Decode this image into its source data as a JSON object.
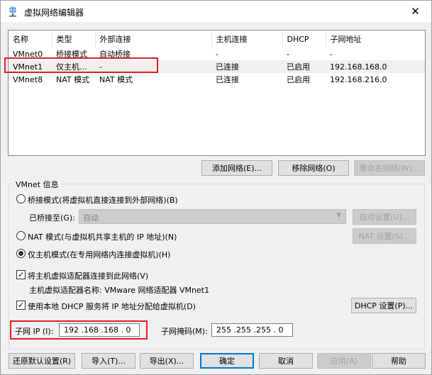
{
  "window": {
    "title": "虚拟网络编辑器",
    "close_glyph": "✕"
  },
  "netlist": {
    "columns": [
      "名称",
      "类型",
      "外部连接",
      "主机连接",
      "DHCP",
      "子网地址"
    ],
    "rows": [
      {
        "name": "VMnet0",
        "type": "桥接模式",
        "external": "自动桥接",
        "host": "-",
        "dhcp": "-",
        "subnet": "-"
      },
      {
        "name": "VMnet1",
        "type": "仅主机...",
        "external": "-",
        "host": "已连接",
        "dhcp": "已启用",
        "subnet": "192.168.168.0"
      },
      {
        "name": "VMnet8",
        "type": "NAT 模式",
        "external": "NAT 模式",
        "host": "已连接",
        "dhcp": "已启用",
        "subnet": "192.168.216.0"
      }
    ]
  },
  "buttons": {
    "add": "添加网络(E)...",
    "remove": "移除网络(O)",
    "rename": "重命名网络(W)...",
    "auto_settings": "自动设置(U)...",
    "nat_settings": "NAT 设置(S)...",
    "dhcp_settings": "DHCP 设置(P)...",
    "restore": "还原默认设置(R)",
    "import": "导入(T)...",
    "export": "导出(X)...",
    "ok": "确定",
    "cancel": "取消",
    "apply": "应用(A)",
    "help": "帮助"
  },
  "vmnet_info": {
    "title": "VMnet 信息",
    "bridge_mode": "桥接模式(将虚拟机直接连接到外部网络)(B)",
    "bridged_to_label": "已桥接至(G):",
    "bridged_to_value": "自动",
    "nat_mode": "NAT 模式(与虚拟机共享主机的 IP 地址)(N)",
    "host_only_mode": "仅主机模式(在专用网络内连接虚拟机)(H)",
    "connect_adapter": "将主机虚拟适配器连接到此网络(V)",
    "adapter_name": "主机虚拟适配器名称: VMware 网络适配器 VMnet1",
    "use_dhcp": "使用本地 DHCP 服务将 IP 地址分配给虚拟机(D)",
    "subnet_ip_label": "子网 IP (I):",
    "subnet_ip_value": "192 .168 .168 .  0",
    "subnet_mask_label": "子网掩码(M):",
    "subnet_mask_value": "255 .255 .255 .  0",
    "selected_mode": "host-only",
    "connect_adapter_checked": true,
    "use_dhcp_checked": true
  },
  "colors": {
    "highlight_box": "#e02020",
    "focus_border": "#0078d7"
  }
}
